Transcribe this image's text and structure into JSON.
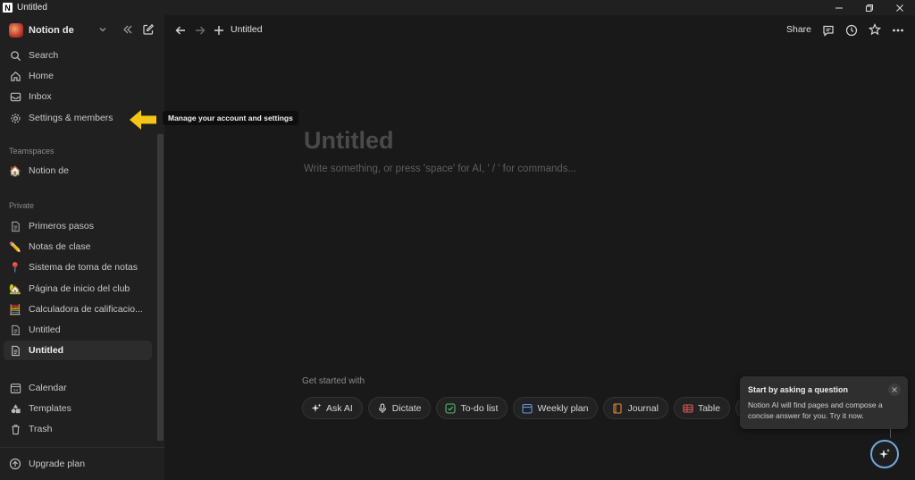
{
  "window": {
    "title": "Untitled",
    "app_icon": "N"
  },
  "sidebar": {
    "workspace_name": "Notion de",
    "nav": [
      {
        "label": "Search",
        "icon": "search-icon"
      },
      {
        "label": "Home",
        "icon": "home-icon"
      },
      {
        "label": "Inbox",
        "icon": "inbox-icon"
      },
      {
        "label": "Settings & members",
        "icon": "gear-icon"
      }
    ],
    "teamspaces_label": "Teamspaces",
    "teamspace": {
      "label": "Notion de",
      "icon": "🏠"
    },
    "private_label": "Private",
    "pages": [
      {
        "label": "Primeros pasos",
        "icon": "page-icon"
      },
      {
        "label": "Notas de clase",
        "icon": "✏️"
      },
      {
        "label": "Sistema de toma de notas",
        "icon": "📍"
      },
      {
        "label": "Página de inicio del club",
        "icon": "🏡"
      },
      {
        "label": "Calculadora de calificacio...",
        "icon": "🧮"
      },
      {
        "label": "Untitled",
        "icon": "page-icon"
      },
      {
        "label": "Untitled",
        "icon": "page-icon",
        "active": true
      }
    ],
    "bottom": [
      {
        "label": "Calendar",
        "icon": "calendar-icon",
        "badge": "24"
      },
      {
        "label": "Templates",
        "icon": "templates-icon"
      },
      {
        "label": "Trash",
        "icon": "trash-icon"
      }
    ],
    "upgrade_label": "Upgrade plan"
  },
  "tooltip": "Manage your account and settings",
  "topbar": {
    "breadcrumb": "Untitled",
    "share_label": "Share"
  },
  "page": {
    "title_placeholder": "Untitled",
    "body_placeholder": "Write something, or press 'space' for AI, ' / ' for commands..."
  },
  "get_started": {
    "label": "Get started with",
    "chips": [
      {
        "label": "Ask AI",
        "icon": "sparkle-icon"
      },
      {
        "label": "Dictate",
        "icon": "microphone-icon"
      },
      {
        "label": "To-do list",
        "icon": "checkbox-icon"
      },
      {
        "label": "Weekly plan",
        "icon": "calendar-icon"
      },
      {
        "label": "Journal",
        "icon": "journal-icon"
      },
      {
        "label": "Table",
        "icon": "table-icon"
      }
    ]
  },
  "ai_popup": {
    "title": "Start by asking a question",
    "body": "Notion AI will find pages and compose a concise answer for you. Try it now."
  },
  "colors": {
    "accent": "#6fa9e0",
    "arrow": "#f5c518"
  }
}
